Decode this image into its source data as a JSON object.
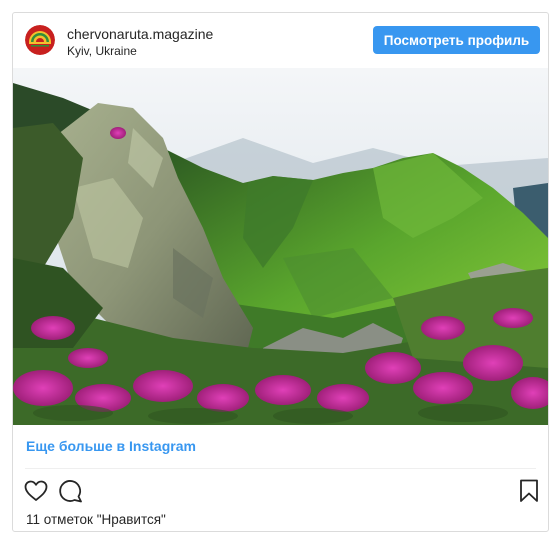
{
  "post": {
    "username": "chervonaruta.magazine",
    "location": "Kyiv, Ukraine",
    "view_profile_label": "Посмотреть профиль",
    "more_link_label": "Еще больше в Instagram",
    "likes_text": "11 отметок \"Нравится\""
  },
  "colors": {
    "accent": "#3897f0",
    "border": "#dbdbdb",
    "text": "#262626"
  },
  "icons": [
    "avatar-logo",
    "heart-icon",
    "comment-icon",
    "bookmark-icon"
  ]
}
